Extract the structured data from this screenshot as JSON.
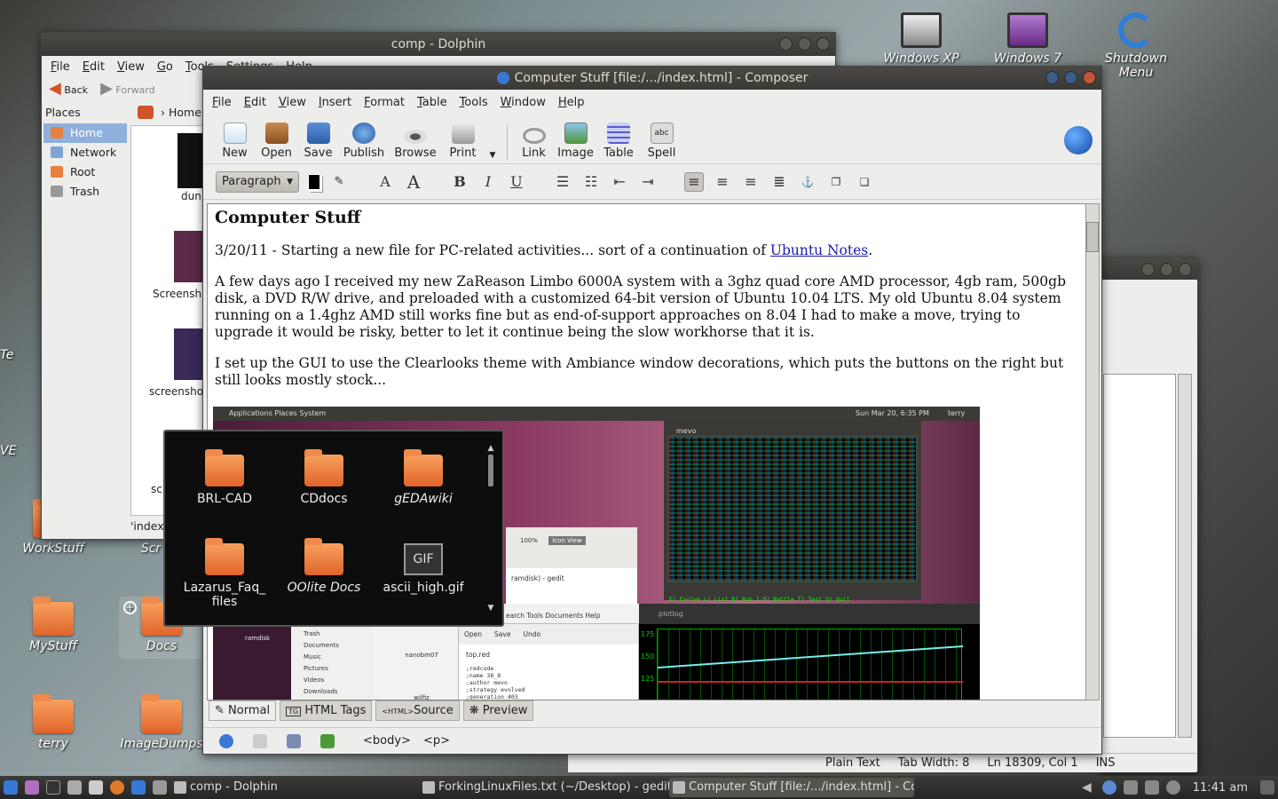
{
  "desktop": {
    "icons": [
      {
        "label": "Windows XP"
      },
      {
        "label": "Windows 7"
      },
      {
        "label": "Shutdown Menu"
      },
      {
        "label": "WorkStuff"
      },
      {
        "label": "Scr"
      },
      {
        "label": "MyStuff"
      },
      {
        "label": "Docs"
      },
      {
        "label": "terry"
      },
      {
        "label": "ImageDumps"
      },
      {
        "label": "Te"
      },
      {
        "label": "VE"
      }
    ]
  },
  "dolphin": {
    "title": "comp - Dolphin",
    "menu": [
      "File",
      "Edit",
      "View",
      "Go",
      "Tools",
      "Settings",
      "Help"
    ],
    "back": "Back",
    "forward": "Forward",
    "places_title": "Places",
    "places": [
      "Home",
      "Network",
      "Root",
      "Trash"
    ],
    "breadcrumb": "Home",
    "files": [
      "dun",
      "Screensh",
      "screensho",
      "scr"
    ],
    "status": "'index"
  },
  "composer": {
    "title": "Computer Stuff [file:/.../index.html] - Composer",
    "menu": [
      "File",
      "Edit",
      "View",
      "Insert",
      "Format",
      "Table",
      "Tools",
      "Window",
      "Help"
    ],
    "toolbar": [
      "New",
      "Open",
      "Save",
      "Publish",
      "Browse",
      "Print",
      "Link",
      "Image",
      "Table",
      "Spell"
    ],
    "paragraph_style": "Paragraph",
    "doc": {
      "heading": "Computer Stuff",
      "p1_before": "3/20/11 - Starting a new file for PC-related activities... sort of a continuation of ",
      "p1_link": "Ubuntu Notes",
      "p1_after": ".",
      "p2": "A few days ago I received my new ZaReason Limbo 6000A system with a 3ghz quad core AMD processor, 4gb ram, 500gb disk, a DVD R/W drive, and preloaded with a customized 64-bit version of Ubuntu 10.04 LTS. My old Ubuntu 8.04 system running on a 1.4ghz AMD still works fine but as end-of-support approaches on 8.04 I had to make a move, trying to upgrade it would be risky, better to let it continue being the slow workhorse that it is.",
      "p3": "I set up the GUI to use the Clearlooks theme with Ambiance window decorations, which puts the buttons on the right but still looks mostly stock..."
    },
    "shot": {
      "panel": "Applications  Places  System",
      "clock": "Sun Mar 20,  6:35 PM",
      "user": "terry",
      "term_title": "mevo",
      "term_footer": "E) Evolve  L) List  R) Run  1-9) Battle  T) Test  Q) Quit",
      "plot_title": "plotlog",
      "plot_y": [
        "175",
        "150",
        "125"
      ],
      "gedit_menu": "earch  Tools  Documents  Help",
      "gedit_title": "ramdisk) - gedit",
      "zoom": "100%",
      "view": "Icon View",
      "side": [
        "Trash",
        "Documents",
        "Music",
        "Pictures",
        "Videos",
        "Downloads"
      ],
      "ramdisk": "ramdisk",
      "folders": [
        "nanobm07",
        "wilfiz"
      ],
      "tab": "top.red",
      "save": "Save",
      "open": "Open",
      "undo": "Undo",
      "code": [
        ";redcode",
        ";name 38_8",
        ";author mevo",
        ";strategy evolved",
        ";generation 403"
      ]
    },
    "tabs": [
      "Normal",
      "HTML Tags",
      "Source",
      "Preview"
    ],
    "status_tags": [
      "<body>",
      "<p>"
    ]
  },
  "gedit": {
    "status": [
      "Plain Text",
      "Tab Width:  8",
      "Ln 18309, Col 1",
      "INS"
    ]
  },
  "popup": {
    "items": [
      "BRL-CAD",
      "CDdocs",
      "gEDAwiki",
      "Lazarus_Faq_\nfiles",
      "OOlite Docs",
      "ascii_high.gif"
    ],
    "gif_label": "GIF"
  },
  "taskbar": {
    "tasks": [
      "comp - Dolphin",
      "ForkingLinuxFiles.txt (~/Desktop) - gedit",
      "Computer Stuff [file:/.../index.html] - Com"
    ],
    "clock": "11:41 am"
  },
  "colors": {
    "accent": "#8fb0dc",
    "folder": "#e8803e",
    "link": "#1a1aa8"
  }
}
